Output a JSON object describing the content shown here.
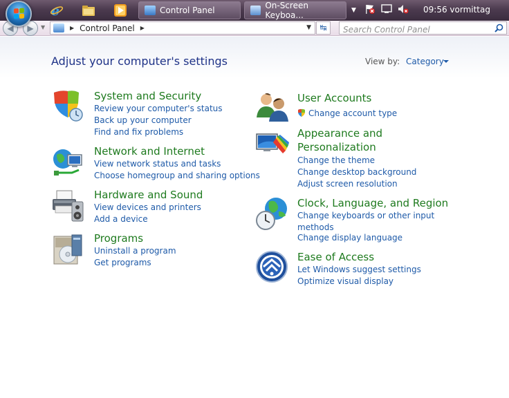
{
  "taskbar": {
    "buttons": [
      {
        "label": "Control Panel"
      },
      {
        "label": "On-Screen Keyboa..."
      }
    ],
    "clock": "09:56 vormittag"
  },
  "address": {
    "path_item": "Control Panel",
    "search_placeholder": "Search Control Panel"
  },
  "header": {
    "title": "Adjust your computer's settings",
    "view_by_label": "View by:",
    "view_by_value": "Category"
  },
  "categories_left": [
    {
      "title": "System and Security",
      "icon": "shield-icon",
      "links": [
        "Review your computer's status",
        "Back up your computer",
        "Find and fix problems"
      ]
    },
    {
      "title": "Network and Internet",
      "icon": "network-globe-icon",
      "links": [
        "View network status and tasks",
        "Choose homegroup and sharing options"
      ]
    },
    {
      "title": "Hardware and Sound",
      "icon": "printer-speaker-icon",
      "links": [
        "View devices and printers",
        "Add a device"
      ]
    },
    {
      "title": "Programs",
      "icon": "programs-disc-icon",
      "links": [
        "Uninstall a program",
        "Get programs"
      ]
    }
  ],
  "categories_right": [
    {
      "title": "User Accounts",
      "icon": "users-icon",
      "links": [
        "Change account type"
      ]
    },
    {
      "title_line1": "Appearance and",
      "title_line2": "Personalization",
      "icon": "monitor-palette-icon",
      "links": [
        "Change the theme",
        "Change desktop background",
        "Adjust screen resolution"
      ]
    },
    {
      "title": "Clock, Language, and Region",
      "icon": "clock-globe-icon",
      "links_line1": "Change keyboards or other input",
      "links_line2": "methods",
      "links": [
        "Change display language"
      ]
    },
    {
      "title": "Ease of Access",
      "icon": "ease-of-access-icon",
      "links": [
        "Let Windows suggest settings",
        "Optimize visual display"
      ]
    }
  ]
}
